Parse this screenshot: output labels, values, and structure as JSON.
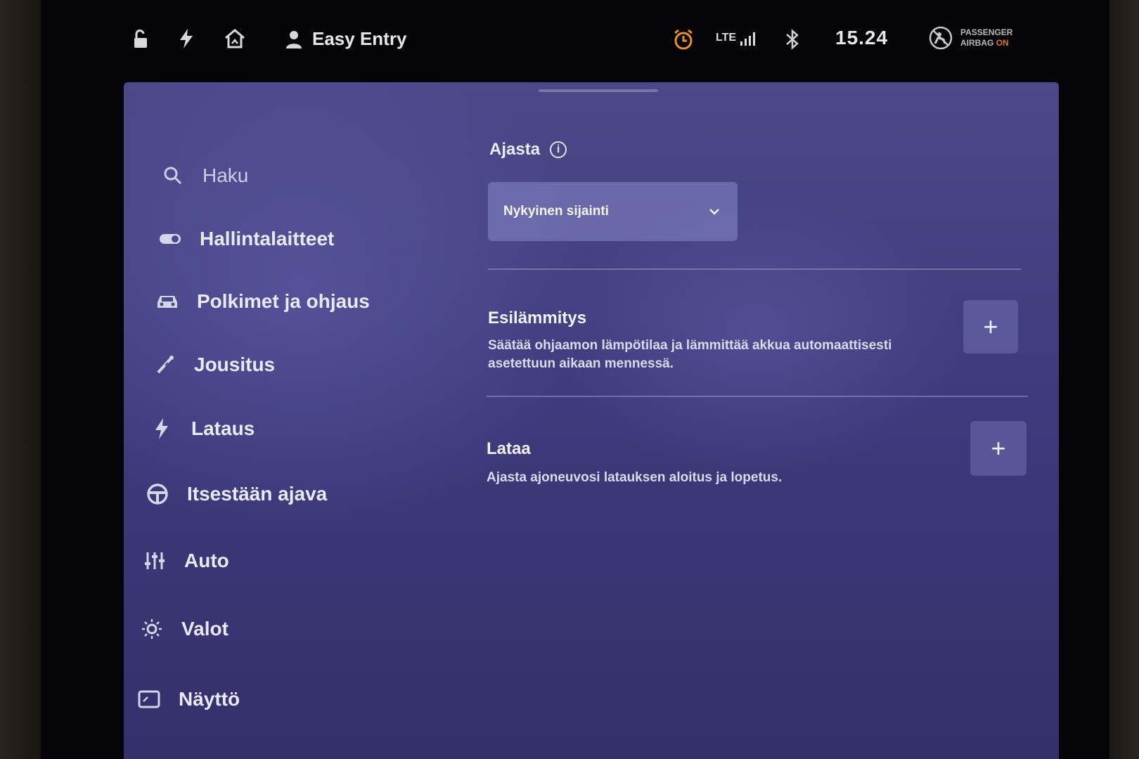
{
  "status_bar": {
    "profile_name": "Easy Entry",
    "network": "LTE",
    "time": "15.24",
    "airbag_line1": "PASSENGER",
    "airbag_line2_prefix": "AIRBAG",
    "airbag_state": "ON",
    "icons": [
      "lock-open-icon",
      "bolt-icon",
      "home-icon",
      "person-icon",
      "alarm-clock-icon",
      "signal-icon",
      "bluetooth-icon",
      "airbag-icon"
    ],
    "colors": {
      "alarm": "#e8902a",
      "airbag_on": "#e07030"
    }
  },
  "sidebar": {
    "items": [
      {
        "label": "Haku",
        "icon": "search-icon"
      },
      {
        "label": "Hallintalaitteet",
        "icon": "toggle-icon"
      },
      {
        "label": "Polkimet ja ohjaus",
        "icon": "car-icon"
      },
      {
        "label": "Jousitus",
        "icon": "suspension-icon"
      },
      {
        "label": "Lataus",
        "icon": "bolt-icon"
      },
      {
        "label": "Itsestään ajava",
        "icon": "steering-wheel-icon"
      },
      {
        "label": "Auto",
        "icon": "sliders-icon"
      },
      {
        "label": "Valot",
        "icon": "light-icon"
      },
      {
        "label": "Näyttö",
        "icon": "display-icon"
      }
    ]
  },
  "main": {
    "schedule_label": "Ajasta",
    "location_select": {
      "selected": "Nykyinen sijainti"
    },
    "sections": [
      {
        "title": "Esilämmitys",
        "description_line1": "Säätää ohjaamon lämpötilaa ja lämmittää akkua automaattisesti",
        "description_line2": "asetettuun aikaan mennessä.",
        "button": "+"
      },
      {
        "title": "Lataa",
        "description_line1": "Ajasta ajoneuvosi latauksen aloitus ja lopetus.",
        "button": "+"
      }
    ]
  },
  "theme": {
    "panel": "#403d80",
    "accent_text": "#ecebf7"
  }
}
